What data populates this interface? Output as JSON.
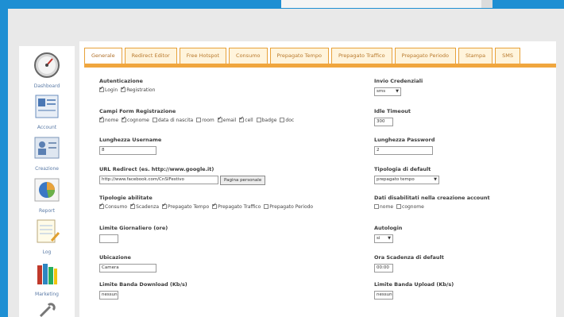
{
  "sidebar": {
    "items": [
      {
        "label": "Dashboard",
        "icon": "gauge-icon"
      },
      {
        "label": "Account",
        "icon": "account-icon"
      },
      {
        "label": "Creazione",
        "icon": "user-card-icon"
      },
      {
        "label": "Report",
        "icon": "pie-chart-icon"
      },
      {
        "label": "Log",
        "icon": "notepad-icon"
      },
      {
        "label": "Marketing",
        "icon": "books-icon"
      },
      {
        "label": "",
        "icon": "tools-icon"
      }
    ]
  },
  "tabs": [
    "Generale",
    "Redirect Editor",
    "Free Hotspot",
    "Consumo",
    "Prepagato Tempo",
    "Prepagato Traffico",
    "Prepagato Periodo",
    "Stampa",
    "SMS"
  ],
  "form": {
    "autenticazione": {
      "label": "Autenticazione",
      "options": [
        {
          "text": "Login",
          "checked": true
        },
        {
          "text": "Registration",
          "checked": true
        }
      ]
    },
    "campi": {
      "label": "Campi Form Registrazione",
      "options": [
        {
          "text": "nome",
          "checked": true
        },
        {
          "text": "cognome",
          "checked": true
        },
        {
          "text": "data di nascita",
          "checked": false
        },
        {
          "text": "room",
          "checked": false
        },
        {
          "text": "email",
          "checked": true
        },
        {
          "text": "cell",
          "checked": true
        },
        {
          "text": "badge",
          "checked": false
        },
        {
          "text": "doc",
          "checked": false
        }
      ]
    },
    "lunghezza_username": {
      "label": "Lunghezza Username",
      "value": "8"
    },
    "url_redirect": {
      "label": "URL Redirect (es. http://www.google.it)",
      "value": "http://www.facebook.com/CnSIFestivo",
      "button": "Pagina personale"
    },
    "tipologie": {
      "label": "Tipologie abilitate",
      "options": [
        {
          "text": "Consumo",
          "checked": true
        },
        {
          "text": "Scadenza",
          "checked": true
        },
        {
          "text": "Prepagato Tempo",
          "checked": true
        },
        {
          "text": "Prepagato Traffico",
          "checked": true
        },
        {
          "text": "Prepagato Periodo",
          "checked": false
        }
      ]
    },
    "limite_giornaliero": {
      "label": "Limite Giornaliero (ore)",
      "value": ""
    },
    "ubicazione": {
      "label": "Ubicazione",
      "value": "Camera"
    },
    "banda_download": {
      "label": "Limite Banda Download (Kb/s)",
      "value": "nessun"
    },
    "invio_credenziali": {
      "label": "Invio Credenziali",
      "value": "sms"
    },
    "idle_timeout": {
      "label": "Idle Timeout",
      "value": "300"
    },
    "lunghezza_password": {
      "label": "Lunghezza Password",
      "value": "2"
    },
    "tipologia_default": {
      "label": "Tipologia di default",
      "value": "prepagato tempo"
    },
    "dati_disabilitati": {
      "label": "Dati disabilitati nella creazione account",
      "options": [
        {
          "text": "nome",
          "checked": false
        },
        {
          "text": "cognome",
          "checked": false
        }
      ]
    },
    "autologin": {
      "label": "Autologin",
      "value": "si"
    },
    "ora_scadenza": {
      "label": "Ora Scadenza di default",
      "value": "00:00"
    },
    "banda_upload": {
      "label": "Limite Banda Upload (Kb/s)",
      "value": "nessun"
    }
  }
}
